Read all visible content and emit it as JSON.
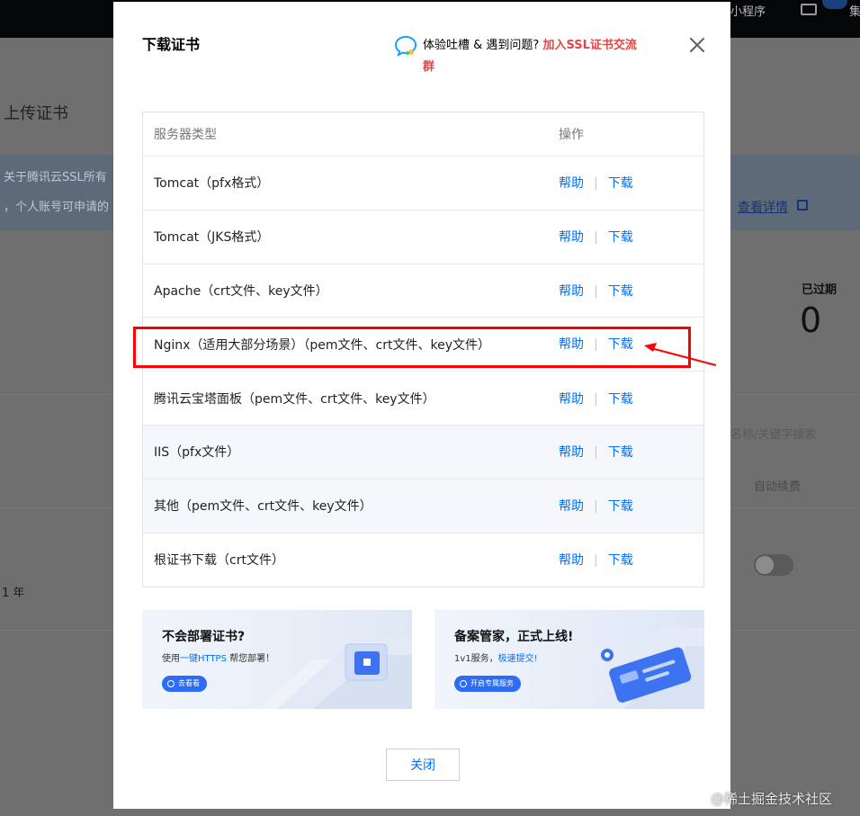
{
  "background": {
    "topbar_item": "小程序",
    "topbar_item_right": "集",
    "tab_upload": "上传证书",
    "notice_line1": "关于腾讯云SSL所有",
    "notice_line2": "，个人账号可申请的",
    "notice_link": "查看详情",
    "expired_label": "已过期",
    "expired_value": "0",
    "search_placeholder": "名称/关键字搜索",
    "column_auto_renew": "自动续费",
    "term": "1 年"
  },
  "modal": {
    "title": "下载证书",
    "feedback_text": "体验吐槽 & 遇到问题?",
    "feedback_link": "加入SSL证书交流",
    "feedback_link_cont": "群",
    "table": {
      "headers": {
        "server_type": "服务器类型",
        "action": "操作"
      },
      "help_label": "帮助",
      "download_label": "下载",
      "rows": [
        {
          "name": "Tomcat（pfx格式）"
        },
        {
          "name": "Tomcat（JKS格式）"
        },
        {
          "name": "Apache（crt文件、key文件）"
        },
        {
          "name": "Nginx（适用大部分场景）（pem文件、crt文件、key文件）"
        },
        {
          "name": "腾讯云宝塔面板（pem文件、crt文件、key文件）"
        },
        {
          "name": "IIS（pfx文件）"
        },
        {
          "name": "其他（pem文件、crt文件、key文件）"
        },
        {
          "name": "根证书下载（crt文件）"
        }
      ]
    },
    "banners": [
      {
        "title": "不会部署证书?",
        "sub_prefix": "使用",
        "sub_highlight": "一键HTTPS",
        "sub_suffix": "帮您部署！",
        "button": "去看看"
      },
      {
        "title": "备案管家，正式上线!",
        "sub_prefix": "1v1服务，",
        "sub_highlight": "极速提交!",
        "sub_suffix": "",
        "button": "开启专属服务"
      }
    ],
    "close_button": "关闭"
  },
  "watermark": "@稀土掘金技术社区",
  "colors": {
    "link_blue": "#006eff",
    "highlight_red": "#ff0000",
    "feedback_red": "#e54545"
  }
}
